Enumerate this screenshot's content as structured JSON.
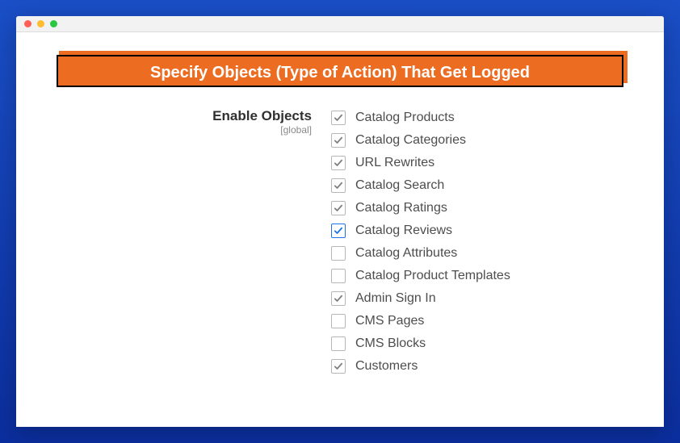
{
  "banner": {
    "title": "Specify Objects (Type of Action) That Get Logged"
  },
  "field": {
    "label": "Enable Objects",
    "scope": "[global]"
  },
  "options": [
    {
      "id": "catalog-products",
      "label": "Catalog Products",
      "checked": true,
      "highlight": false
    },
    {
      "id": "catalog-categories",
      "label": "Catalog Categories",
      "checked": true,
      "highlight": false
    },
    {
      "id": "url-rewrites",
      "label": "URL Rewrites",
      "checked": true,
      "highlight": false
    },
    {
      "id": "catalog-search",
      "label": "Catalog Search",
      "checked": true,
      "highlight": false
    },
    {
      "id": "catalog-ratings",
      "label": "Catalog Ratings",
      "checked": true,
      "highlight": false
    },
    {
      "id": "catalog-reviews",
      "label": "Catalog Reviews",
      "checked": true,
      "highlight": true
    },
    {
      "id": "catalog-attributes",
      "label": "Catalog Attributes",
      "checked": false,
      "highlight": false
    },
    {
      "id": "catalog-product-templates",
      "label": "Catalog Product Templates",
      "checked": false,
      "highlight": false
    },
    {
      "id": "admin-sign-in",
      "label": "Admin Sign In",
      "checked": true,
      "highlight": false
    },
    {
      "id": "cms-pages",
      "label": "CMS Pages",
      "checked": false,
      "highlight": false
    },
    {
      "id": "cms-blocks",
      "label": "CMS Blocks",
      "checked": false,
      "highlight": false
    },
    {
      "id": "customers",
      "label": "Customers",
      "checked": true,
      "highlight": false
    }
  ]
}
